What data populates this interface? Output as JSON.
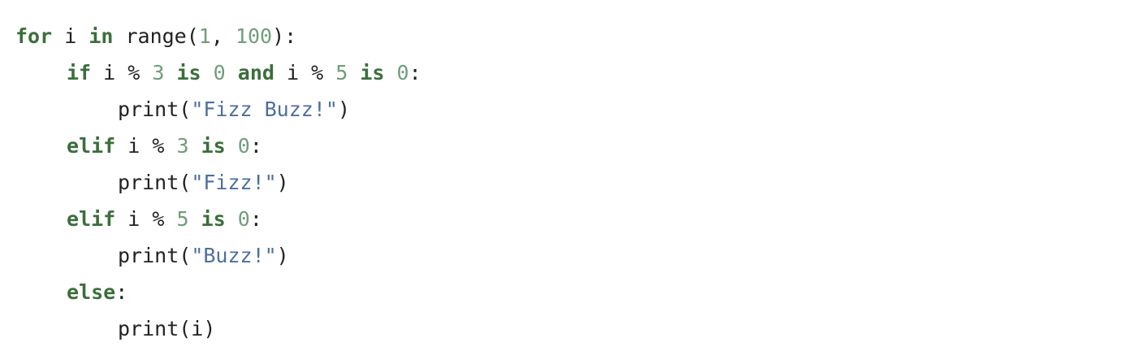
{
  "code": {
    "line1": {
      "kw_for": "for",
      "var": " i ",
      "kw_in": "in",
      "call": " range(",
      "num1": "1",
      "sep": ", ",
      "num2": "100",
      "end": "):"
    },
    "line2": {
      "kw_if": "if",
      "p1": " i % ",
      "n1": "3",
      "sp1": " ",
      "kw_is1": "is",
      "sp2": " ",
      "n2": "0",
      "sp3": " ",
      "kw_and": "and",
      "p2": " i % ",
      "n3": "5",
      "sp4": " ",
      "kw_is2": "is",
      "sp5": " ",
      "n4": "0",
      "end": ":"
    },
    "line3": {
      "call": "print(",
      "str": "\"Fizz Buzz!\"",
      "end": ")"
    },
    "line4": {
      "kw_elif": "elif",
      "p1": " i % ",
      "n1": "3",
      "sp1": " ",
      "kw_is": "is",
      "sp2": " ",
      "n2": "0",
      "end": ":"
    },
    "line5": {
      "call": "print(",
      "str": "\"Fizz!\"",
      "end": ")"
    },
    "line6": {
      "kw_elif": "elif",
      "p1": " i % ",
      "n1": "5",
      "sp1": " ",
      "kw_is": "is",
      "sp2": " ",
      "n2": "0",
      "end": ":"
    },
    "line7": {
      "call": "print(",
      "str": "\"Buzz!\"",
      "end": ")"
    },
    "line8": {
      "kw_else": "else",
      "end": ":"
    },
    "line9": {
      "call": "print(i)"
    }
  },
  "colors": {
    "keyword": "#3b6e3b",
    "number": "#6f9e7a",
    "string": "#4d6f9e",
    "text": "#222222",
    "background": "#ffffff"
  }
}
